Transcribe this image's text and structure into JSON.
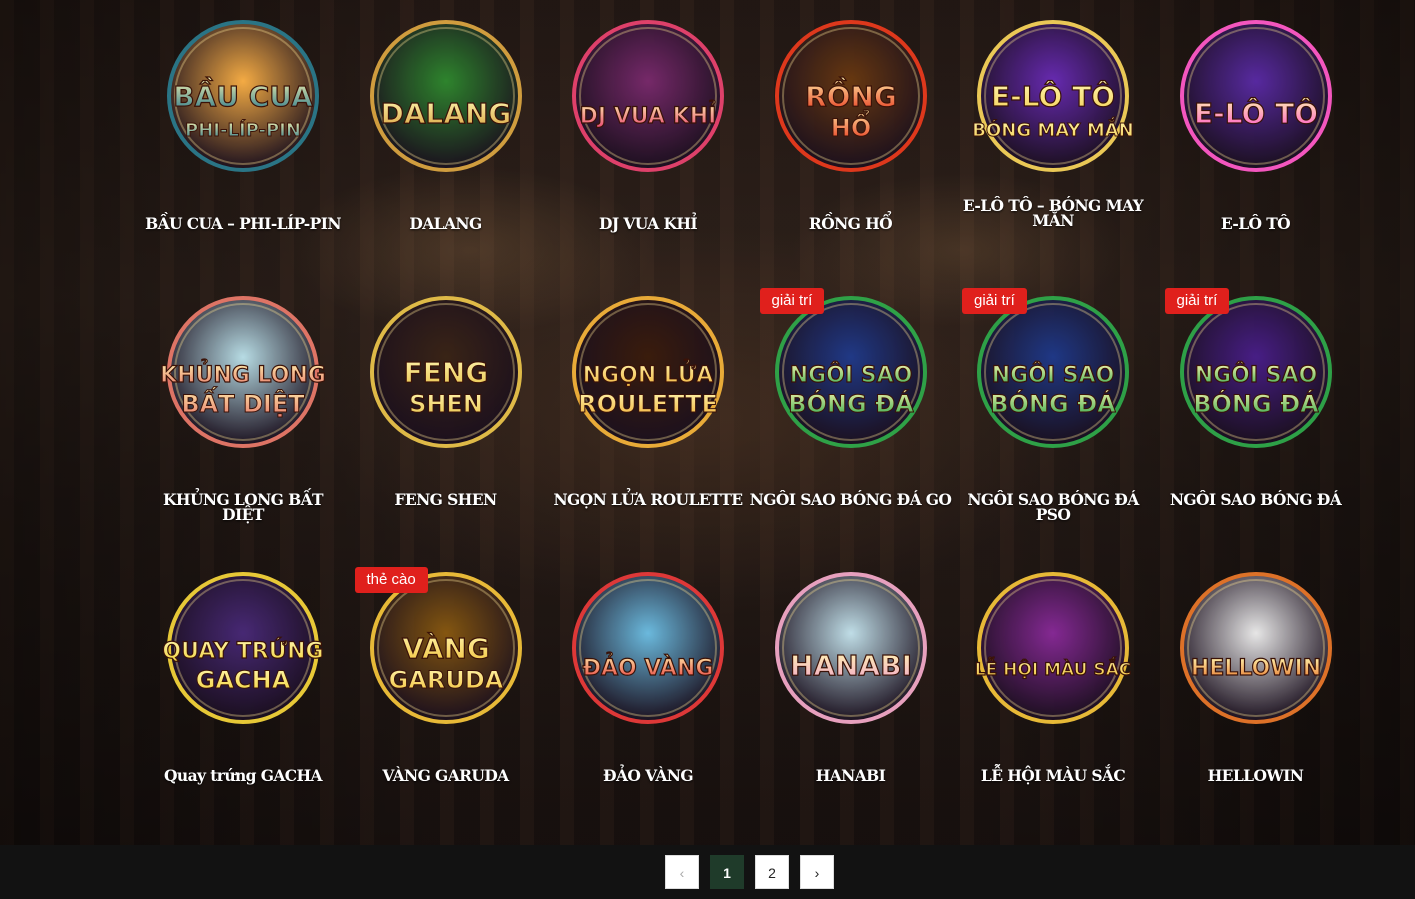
{
  "games": [
    {
      "name": "BẦU CUA – PHI-LÍP-PIN",
      "logo": "BẦU CUA",
      "logo2": "PHI-LÍP-PIN",
      "colors": [
        "#ffb347",
        "#2b7a8c"
      ],
      "icon": "bau-cua-logo"
    },
    {
      "name": "DALANG",
      "logo": "DALANG",
      "logo2": "",
      "colors": [
        "#2f8a2f",
        "#d9a441"
      ],
      "icon": "dalang-logo"
    },
    {
      "name": "DJ VUA KHỈ",
      "logo": "DJ VUA KHỈ",
      "logo2": "",
      "colors": [
        "#7a2a6e",
        "#e8436f"
      ],
      "icon": "dj-vua-khi-logo"
    },
    {
      "name": "RỒNG HỔ",
      "logo": "RỒNG",
      "logo2": "HỔ",
      "colors": [
        "#6b3a10",
        "#e83a1d"
      ],
      "icon": "rong-ho-logo"
    },
    {
      "name": "E-LÔ TÔ – BÓNG MAY MẮN",
      "logo": "E-LÔ TÔ",
      "logo2": "BÓNG MAY MẮN",
      "colors": [
        "#6a2bb8",
        "#f5d25a"
      ],
      "icon": "e-lo-to-bong-may-man-logo"
    },
    {
      "name": "E-LÔ TÔ",
      "logo": "E-LÔ TÔ",
      "logo2": "",
      "colors": [
        "#5b2ba8",
        "#ff5ac8"
      ],
      "icon": "e-lo-to-logo"
    },
    {
      "name": "KHỦNG LONG BẤT DIỆT",
      "logo": "KHỦNG LONG",
      "logo2": "BẤT DIỆT",
      "colors": [
        "#bfe6ef",
        "#e8796a"
      ],
      "icon": "khung-long-logo"
    },
    {
      "name": "FENG SHEN",
      "logo": "FENG",
      "logo2": "SHEN",
      "colors": [
        "#3a2416",
        "#e8c24a"
      ],
      "icon": "feng-shen-logo"
    },
    {
      "name": "NGỌN LỬA ROULETTE",
      "logo": "NGỌN LỬA",
      "logo2": "ROULETTE",
      "colors": [
        "#3a1c0c",
        "#f2b23a"
      ],
      "icon": "ngon-lua-roulette-logo"
    },
    {
      "name": "NGÔI SAO BÓNG ĐÁ GO",
      "logo": "NGÔI SAO",
      "logo2": "BÓNG ĐÁ",
      "colors": [
        "#1f3a8c",
        "#2fa84a"
      ],
      "icon": "ngoi-sao-bong-da-go-logo",
      "badge": "giải trí"
    },
    {
      "name": "NGÔI SAO BÓNG ĐÁ PSO",
      "logo": "NGÔI SAO",
      "logo2": "BÓNG ĐÁ",
      "colors": [
        "#1f3a8c",
        "#2fa84a"
      ],
      "icon": "ngoi-sao-bong-da-pso-logo",
      "badge": "giải trí"
    },
    {
      "name": "NGÔI SAO BÓNG ĐÁ",
      "logo": "NGÔI SAO",
      "logo2": "BÓNG ĐÁ",
      "colors": [
        "#4a1f8c",
        "#2fa84a"
      ],
      "icon": "ngoi-sao-bong-da-logo",
      "badge": "giải trí"
    },
    {
      "name": "Quay trứng GACHA",
      "logo": "QUAY TRỨNG",
      "logo2": "GACHA",
      "colors": [
        "#4a2a7a",
        "#f2d23a"
      ],
      "icon": "quay-trung-gacha-logo"
    },
    {
      "name": "VÀNG GARUDA",
      "logo": "VÀNG",
      "logo2": "GARUDA",
      "colors": [
        "#8a5a10",
        "#f2c23a"
      ],
      "icon": "vang-garuda-logo",
      "badge": "thẻ cào"
    },
    {
      "name": "ĐẢO VÀNG",
      "logo": "ĐẢO VÀNG",
      "logo2": "",
      "colors": [
        "#6fc2e8",
        "#e83a3a"
      ],
      "icon": "dao-vang-logo"
    },
    {
      "name": "HANABI",
      "logo": "HANABI",
      "logo2": "",
      "colors": [
        "#c8e8f2",
        "#f2a8c8"
      ],
      "icon": "hanabi-logo"
    },
    {
      "name": "LỄ HỘI MÀU SẮC",
      "logo": "LỄ HỘI MÀU SẮC",
      "logo2": "",
      "colors": [
        "#8a2a9a",
        "#f2c23a"
      ],
      "icon": "le-hoi-mau-sac-logo"
    },
    {
      "name": "HELLOWIN",
      "logo": "HELLOWIN",
      "logo2": "",
      "colors": [
        "#f2f2f2",
        "#e8772a"
      ],
      "icon": "hellowin-logo"
    }
  ],
  "pagination": {
    "prev": "‹",
    "pages": [
      "1",
      "2"
    ],
    "current": "1",
    "next": "›"
  }
}
